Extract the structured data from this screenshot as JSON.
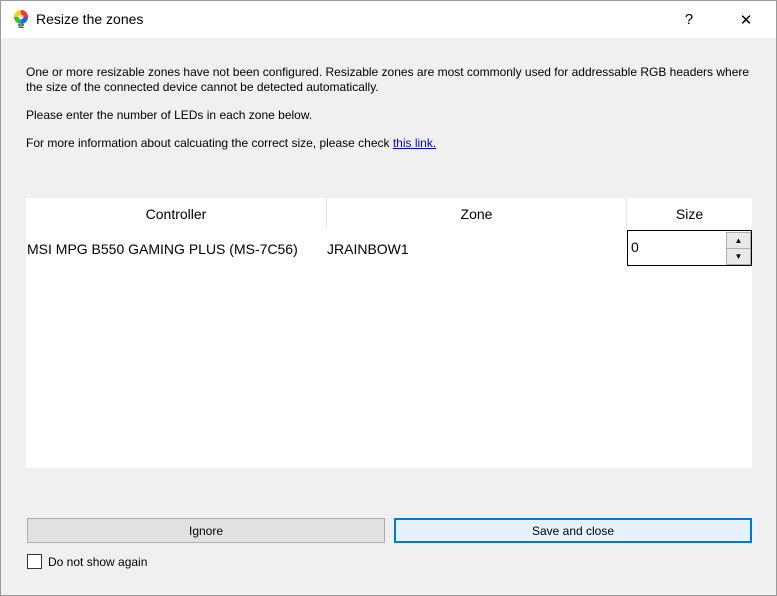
{
  "window": {
    "title": "Resize the zones",
    "help_glyph": "?",
    "close_glyph": "✕"
  },
  "messages": {
    "line1": "One or more resizable zones have not been configured. Resizable zones are most commonly used for addressable RGB headers where the size of the connected device cannot be detected automatically.",
    "line2": "Please enter the number of LEDs in each zone below.",
    "line3_prefix": "For more information about calcuating the correct size, please check ",
    "line3_link": "this link."
  },
  "table": {
    "columns": [
      "Controller",
      "Zone",
      "Size"
    ],
    "rows": [
      {
        "controller": "MSI MPG B550 GAMING PLUS (MS-7C56)",
        "zone": "JRAINBOW1",
        "size": "0"
      }
    ]
  },
  "buttons": {
    "ignore": "Ignore",
    "save_close": "Save and close"
  },
  "checkbox": {
    "label": "Do not show again",
    "checked": false
  },
  "icons": {
    "app": "rgb-bulb-icon",
    "help": "help-icon",
    "close": "close-icon",
    "spin_up": "chevron-up-icon",
    "spin_down": "chevron-down-icon"
  },
  "colors": {
    "accent": "#0078d7",
    "link": "#0000ee",
    "background": "#f0f0f0",
    "titlebar": "#ffffff"
  }
}
